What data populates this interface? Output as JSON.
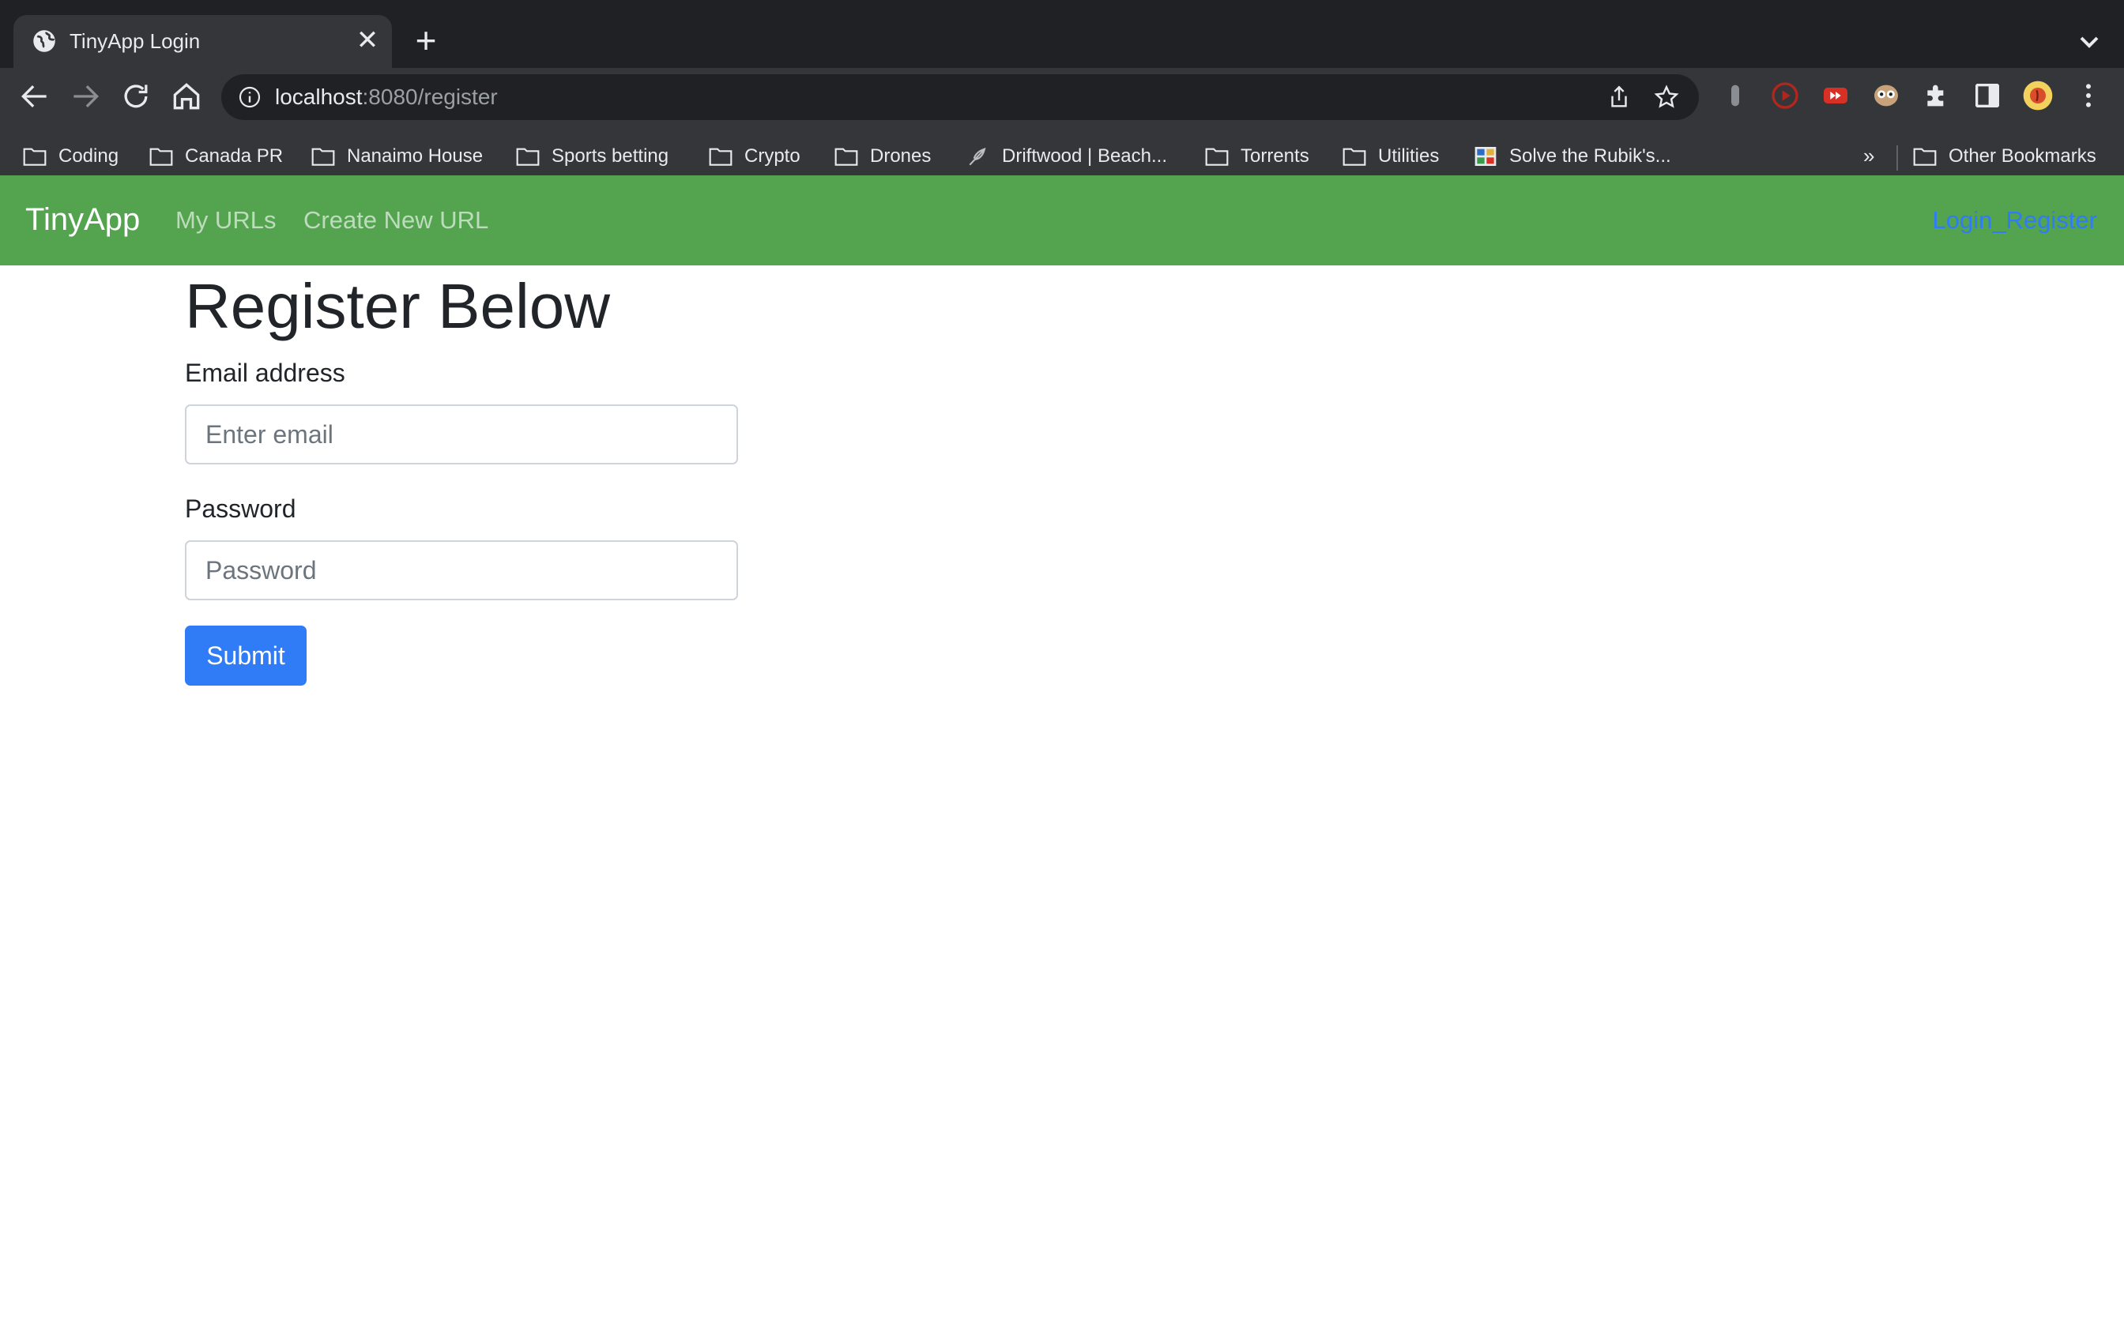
{
  "browser": {
    "tab": {
      "title": "TinyApp Login",
      "close_glyph": "✕",
      "favicon": "globe-icon"
    },
    "new_tab_glyph": "+",
    "address_bar": {
      "host": "localhost",
      "path": ":8080/register"
    },
    "bookmarks": [
      {
        "label": "Coding",
        "icon": "folder-icon"
      },
      {
        "label": "Canada PR",
        "icon": "folder-icon"
      },
      {
        "label": "Nanaimo House",
        "icon": "folder-icon"
      },
      {
        "label": "Sports betting",
        "icon": "folder-icon"
      },
      {
        "label": "Crypto",
        "icon": "folder-icon"
      },
      {
        "label": "Drones",
        "icon": "folder-icon"
      },
      {
        "label": "Driftwood | Beach...",
        "icon": "feather-icon"
      },
      {
        "label": "Torrents",
        "icon": "folder-icon"
      },
      {
        "label": "Utilities",
        "icon": "folder-icon"
      },
      {
        "label": "Solve the Rubik's...",
        "icon": "rubiks-icon"
      }
    ],
    "bookmarks_overflow": "»",
    "other_bookmarks": "Other Bookmarks"
  },
  "navbar": {
    "brand": "TinyApp",
    "links": [
      "My URLs",
      "Create New URL"
    ],
    "right_link": "Login_Register"
  },
  "form": {
    "heading": "Register Below",
    "email_label": "Email address",
    "email_placeholder": "Enter email",
    "password_label": "Password",
    "password_placeholder": "Password",
    "submit_label": "Submit"
  },
  "colors": {
    "navbar_bg": "#53a34f",
    "primary": "#2f7cf6",
    "chrome_dark": "#202124",
    "chrome_toolbar": "#35363a"
  }
}
